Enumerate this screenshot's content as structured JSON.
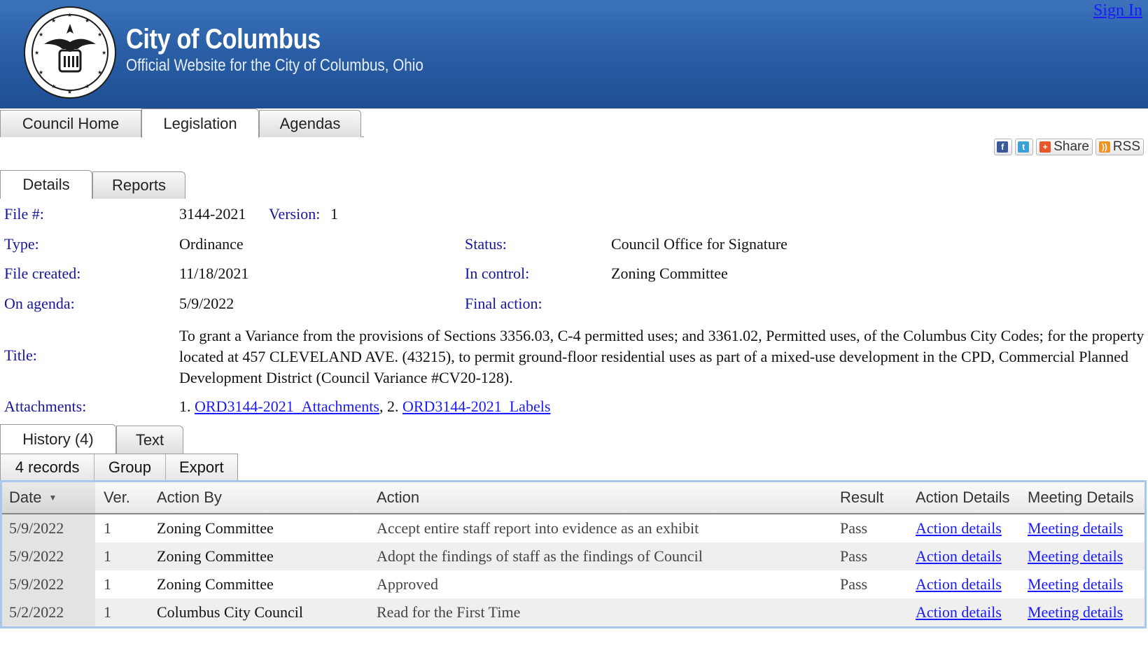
{
  "header": {
    "title": "City of Columbus",
    "subtitle": "Official Website for the City of Columbus, Ohio",
    "sign_in": "Sign In"
  },
  "top_tabs": [
    "Council Home",
    "Legislation",
    "Agendas"
  ],
  "active_top_tab": "Legislation",
  "share_bar": {
    "share": "Share",
    "rss": "RSS"
  },
  "detail_tabs": [
    "Details",
    "Reports"
  ],
  "details": {
    "file_label": "File #:",
    "file_value": "3144-2021",
    "version_label": "Version:",
    "version_value": "1",
    "type_label": "Type:",
    "type_value": "Ordinance",
    "status_label": "Status:",
    "status_value": "Council Office for Signature",
    "created_label": "File created:",
    "created_value": "11/18/2021",
    "control_label": "In control:",
    "control_value": "Zoning Committee",
    "agenda_label": "On agenda:",
    "agenda_value": "5/9/2022",
    "final_label": "Final action:",
    "final_value": "",
    "title_label": "Title:",
    "title_value": "To grant a Variance from the provisions of Sections 3356.03, C-4 permitted uses; and 3361.02, Permitted uses, of the Columbus City Codes; for the property located at 457 CLEVELAND AVE. (43215), to permit ground-floor residential uses as part of a mixed-use development in the CPD, Commercial Planned Development District (Council Variance #CV20-128).",
    "attachments_label": "Attachments:",
    "attachment_1_num": "1.",
    "attachment_1": "ORD3144-2021_Attachments",
    "attachment_sep": ", 2.",
    "attachment_2": "ORD3144-2021_Labels"
  },
  "history_tabs": [
    "History (4)",
    "Text"
  ],
  "toolbar": {
    "records": "4 records",
    "group": "Group",
    "export": "Export"
  },
  "history_columns": [
    "Date",
    "Ver.",
    "Action By",
    "Action",
    "Result",
    "Action Details",
    "Meeting Details"
  ],
  "history_rows": [
    {
      "date": "5/9/2022",
      "ver": "1",
      "by": "Zoning Committee",
      "action": "Accept entire staff report into evidence as an exhibit",
      "result": "Pass",
      "action_details": "Action details",
      "meeting_details": "Meeting details"
    },
    {
      "date": "5/9/2022",
      "ver": "1",
      "by": "Zoning Committee",
      "action": "Adopt the findings of staff as the findings of Council",
      "result": "Pass",
      "action_details": "Action details",
      "meeting_details": "Meeting details"
    },
    {
      "date": "5/9/2022",
      "ver": "1",
      "by": "Zoning Committee",
      "action": "Approved",
      "result": "Pass",
      "action_details": "Action details",
      "meeting_details": "Meeting details"
    },
    {
      "date": "5/2/2022",
      "ver": "1",
      "by": "Columbus City Council",
      "action": "Read for the First Time",
      "result": "",
      "action_details": "Action details",
      "meeting_details": "Meeting details"
    }
  ],
  "colors": {
    "banner": "#2a5fa6",
    "label": "#15159a",
    "link": "#1a1aff",
    "grid_border": "#a9c6ec"
  }
}
